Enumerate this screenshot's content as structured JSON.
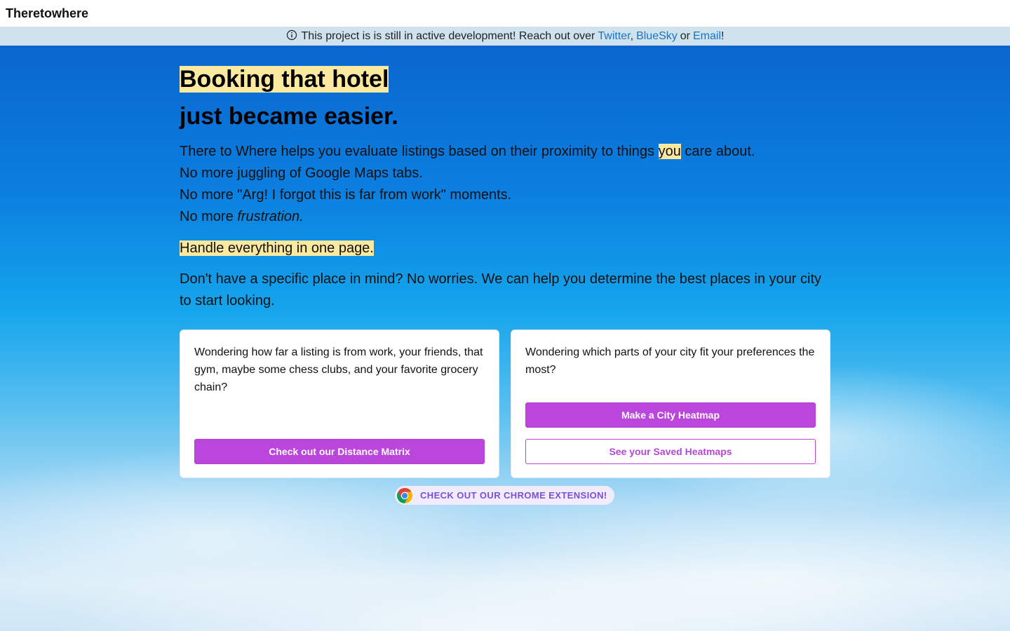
{
  "header": {
    "brand": "Theretowhere"
  },
  "notice": {
    "icon": "info-icon",
    "text": "This project is is still in active development! Reach out over",
    "link_twitter": "Twitter",
    "sep1": ",",
    "link_bluesky": "BlueSky",
    "or": "or",
    "link_email": "Email",
    "end": "!"
  },
  "hero": {
    "title_line1": "Booking that hotel",
    "title_line2": "just became easier.",
    "lead_line1_pre": "There to Where helps you evaluate listings based on their proximity to things ",
    "lead_line1_em": "you",
    "lead_line1_post": " care about.",
    "lead_line2": "No more juggling of Google Maps tabs.",
    "lead_line3": "No more \"Arg! I forgot this is far from work\" moments.",
    "lead_line4_pre": "No more ",
    "lead_line4_em": "frustration.",
    "callout": "Handle everything in one page.",
    "paragraph": "Don't have a specific place in mind? No worries. We can help you determine the best places in your city to start looking."
  },
  "cards": {
    "left": {
      "text": "Wondering how far a listing is from work, your friends, that gym, maybe some chess clubs, and your favorite grocery chain?",
      "button": "Check out our Distance Matrix"
    },
    "right": {
      "text": "Wondering which parts of your city fit your preferences the most?",
      "button_primary": "Make a City Heatmap",
      "button_secondary": "See your Saved Heatmaps"
    }
  },
  "extension": {
    "icon": "chrome-icon",
    "label": "CHECK OUT OUR CHROME EXTENSION!"
  },
  "colors": {
    "accent": "#bb46dc",
    "highlight": "#fbe9a0",
    "link": "#1a73c7",
    "notice_bg": "#cfe3ef"
  }
}
